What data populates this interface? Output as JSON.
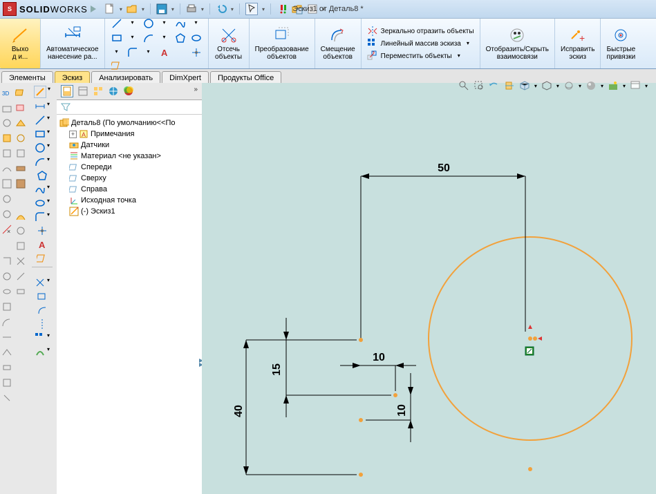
{
  "title_doc": "Эскиз1 от Деталь8 *",
  "brand_bold": "SOLID",
  "brand_thin": "WORKS",
  "ribbon": {
    "exit": "Выхо\nд и...",
    "auto_dim": "Автоматическое\nнанесение ра...",
    "trim": "Отсечь\nобъекты",
    "convert": "Преобразование\nобъектов",
    "offset": "Смещение\nобъектов",
    "mirror": "Зеркально отразить объекты",
    "linear": "Линейный массив эскиза",
    "move": "Переместить объекты",
    "relations": "Отобразить/Скрыть\nвзаимосвязи",
    "repair": "Исправить\nэскиз",
    "snaps": "Быстрые\nпривязки"
  },
  "tabs": {
    "features": "Элементы",
    "sketch": "Эскиз",
    "analyze": "Анализировать",
    "dimxpert": "DimXpert",
    "office": "Продукты Office"
  },
  "tree": {
    "root": "Деталь8  (По умолчанию<<По",
    "notes": "Примечания",
    "sensors": "Датчики",
    "material": "Материал <не указан>",
    "front": "Спереди",
    "top": "Сверху",
    "right": "Справа",
    "origin": "Исходная точка",
    "sketch1": "(-) Эскиз1"
  },
  "dims": {
    "d50": "50",
    "d40": "40",
    "d15": "15",
    "d10a": "10",
    "d10b": "10"
  }
}
